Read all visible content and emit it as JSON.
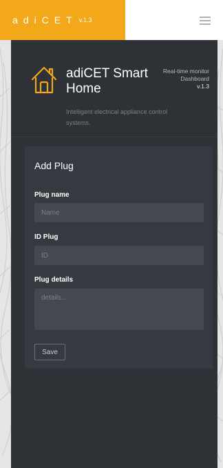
{
  "topbar": {
    "brand_name": "adiCET",
    "brand_version": "v.1.3",
    "menu_icon": "hamburger-menu-icon"
  },
  "header": {
    "logo_icon": "house-icon",
    "title": "adiCET Smart Home",
    "description": "Intelligent electrical appliance control systems.",
    "meta_line1": "Real-time monitor",
    "meta_line2": "Dashboard",
    "meta_version": "v.1.3"
  },
  "form": {
    "title": "Add Plug",
    "plug_name_label": "Plug name",
    "plug_name_placeholder": "Name",
    "plug_name_value": "",
    "id_label": "ID Plug",
    "id_placeholder": "ID",
    "id_value": "",
    "details_label": "Plug details",
    "details_placeholder": "details...",
    "details_value": "",
    "save_label": "Save"
  },
  "colors": {
    "accent": "#f3a81a",
    "panel_bg": "#2e3237",
    "card_bg": "#363a40",
    "input_bg": "#444950"
  }
}
